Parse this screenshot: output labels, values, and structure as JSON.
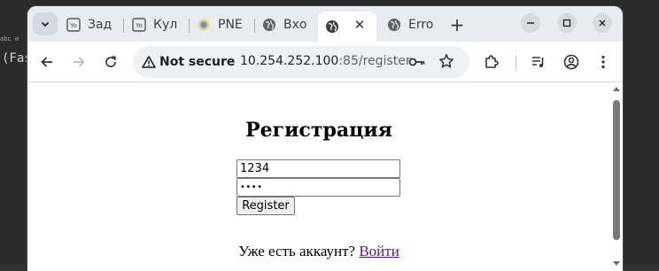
{
  "background": {
    "terminal_top": "abc ⌀",
    "terminal_line": "(Fas"
  },
  "tabs": [
    {
      "label": "Зад",
      "icon": "yo-site-icon"
    },
    {
      "label": "Кул",
      "icon": "yo-site-icon"
    },
    {
      "label": "PNE",
      "icon": "colorful-site-icon"
    },
    {
      "label": "Вхо",
      "icon": "globe-icon"
    },
    {
      "label": "",
      "icon": "globe-icon",
      "active": true
    },
    {
      "label": "Erro",
      "icon": "globe-icon"
    }
  ],
  "address_bar": {
    "security_label": "Not secure",
    "host": "10.254.252.100",
    "port_path": ":85/register"
  },
  "page": {
    "title": "Регистрация",
    "username_value": "1234",
    "password_value": "••••",
    "register_label": "Register",
    "login_prompt": "Уже есть аккаунт?",
    "login_link": "Войти"
  },
  "colors": {
    "tabstrip": "#e8ecf1",
    "link_visited": "#551a8b"
  }
}
